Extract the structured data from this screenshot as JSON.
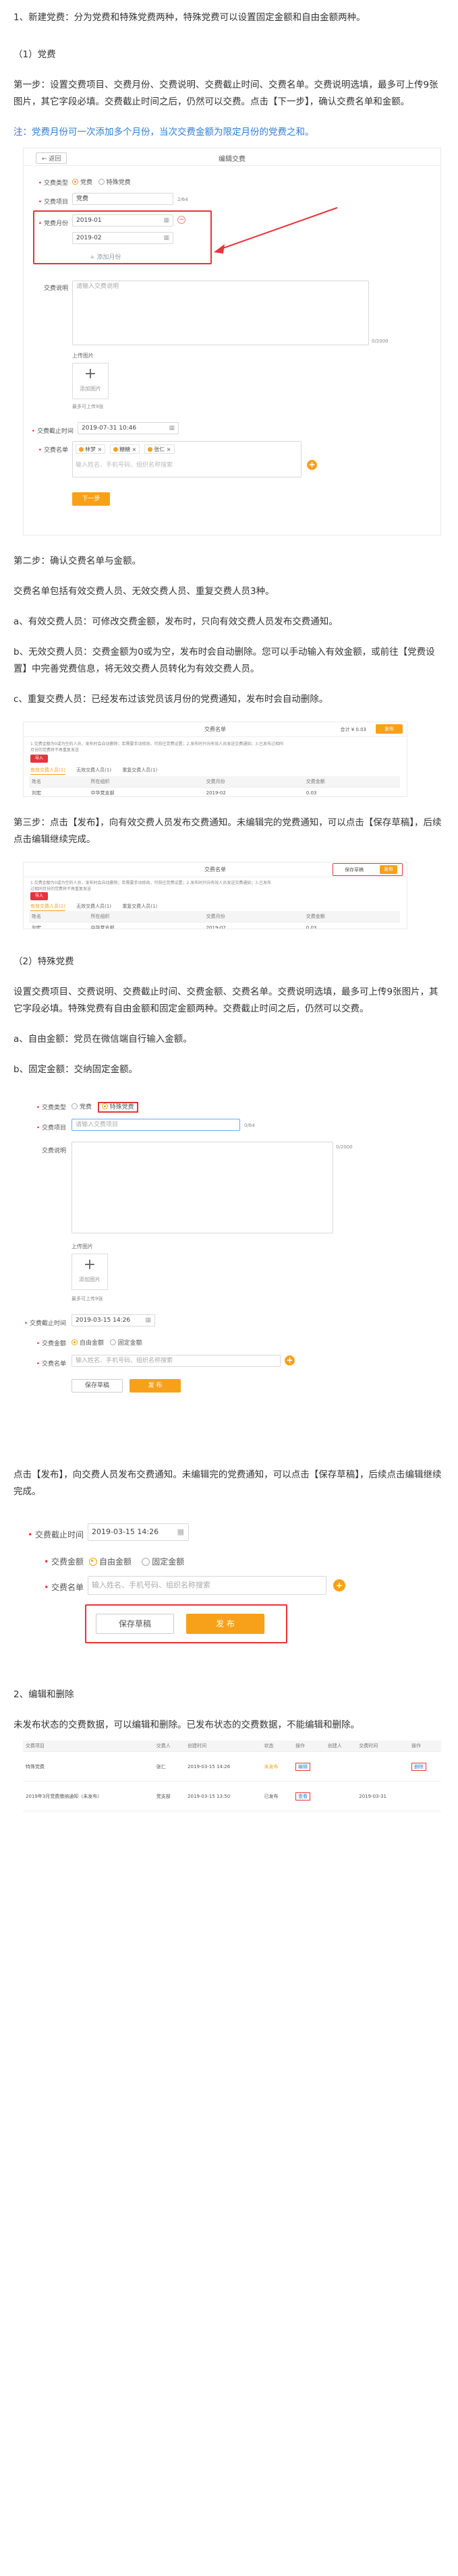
{
  "intro": "1、新建党费：分为党费和特殊党费两种，特殊党费可以设置固定金额和自由金额两种。",
  "section1": {
    "heading": "（1）党费",
    "step1": "第一步：设置交费项目、交费月份、交费说明、交费截止时间、交费名单。交费说明选填，最多可上传9张图片，其它字段必填。交费截止时间之后，仍然可以交费。点击【下一步】，确认交费名单和金额。",
    "note": "注：党费月份可一次添加多个月份，当次交费金额为限定月份的党费之和。",
    "form": {
      "back": "返回",
      "title": "编辑交费",
      "type_label": "交费类型",
      "type_options": [
        "党费",
        "特殊党费"
      ],
      "project_label": "交费项目",
      "project_value": "党费",
      "project_count": "2/64",
      "month_label": "党费月份",
      "months": [
        "2019-01",
        "2019-02"
      ],
      "add_month": "+ 添加月份",
      "desc_label": "交费说明",
      "desc_placeholder": "请输入交费说明",
      "desc_count": "0/2000",
      "upload_label": "上传图片",
      "upload_btn": "添加图片",
      "upload_tip": "最多可上传9张",
      "deadline_label": "交费截止时间",
      "deadline_value": "2019-07-31 10:46",
      "list_label": "交费名单",
      "list_tags": [
        "林梦",
        "糖糖",
        "张仁"
      ],
      "list_placeholder": "输入姓名、手机号码、组织名称搜索",
      "next_btn": "下一步"
    },
    "step2": "第二步：确认交费名单与金额。",
    "list_types": "交费名单包括有效交费人员、无效交费人员、重复交费人员3种。",
    "a": "a、有效交费人员：可修改交费金额，发布时，只向有效交费人员发布交费通知。",
    "b": "b、无效交费人员：交费金额为0或为空，发布时会自动删除。您可以手动输入有效金额，或前往【党费设置】中完善党费信息，将无效交费人员转化为有效交费人员。",
    "c": "c、重复交费人员：已经发布过该党员该月份的党费通知，发布时会自动删除。",
    "table1": {
      "title": "交费名单",
      "total_label": "合计 ¥ 0.03",
      "save_btn": "保存草稿",
      "publish_btn": "发布",
      "info": "1.交费金额为0或为空的人员，发布时会自动删除；若需要手动修改，可前往党费设置；2.发布时只向有效人员发送交费通知；3.已发布过相同月份的党费将不再重复发送",
      "import_btn": "导入",
      "tabs": [
        "有效交费人员(1)",
        "无效交费人员(1)",
        "重复交费人员(1)"
      ],
      "cols": [
        "姓名",
        "所在组织",
        "交费月份",
        "交费金额"
      ],
      "rows": [
        [
          "刘宏",
          "中华党支部",
          "2019-02",
          "0.03"
        ]
      ]
    },
    "step3": "第三步：点击【发布】，向有效交费人员发布交费通知。未编辑完的党费通知，可以点击【保存草稿】，后续点击编辑继续完成。"
  },
  "section2": {
    "heading": "（2）特殊党费",
    "desc": "设置交费项目、交费说明、交费截止时间、交费金额、交费名单。交费说明选填，最多可上传9张图片，其它字段必填。特殊党费有自由金额和固定金额两种。交费截止时间之后，仍然可以交费。",
    "a": "a、自由金额：党员在微信端自行输入金额。",
    "b": "b、固定金额：交纳固定金额。",
    "form": {
      "type_label": "交费类型",
      "type_options": [
        "党费",
        "特殊党费"
      ],
      "project_label": "交费项目",
      "project_placeholder": "请输入交费项目",
      "project_count": "0/64",
      "desc_label": "交费说明",
      "desc_count": "0/2000",
      "upload_label": "上传图片",
      "upload_btn": "添加图片",
      "upload_tip": "最多可上传9张",
      "deadline_label": "交费截止时间",
      "deadline_value": "2019-03-15 14:26",
      "amount_label": "交费金额",
      "amount_options": [
        "自由金额",
        "固定金额"
      ],
      "list_label": "交费名单",
      "list_placeholder": "输入姓名、手机号码、组织名称搜索",
      "save_btn": "保存草稿",
      "publish_btn": "发 布"
    },
    "publish_text": "点击【发布】，向交费人员发布交费通知。未编辑完的党费通知，可以点击【保存草稿】，后续点击编辑继续完成。",
    "zoom": {
      "deadline_label": "交费截止时间",
      "deadline_value": "2019-03-15 14:26",
      "amount_label": "交费金额",
      "amount_options": [
        "自由金额",
        "固定金额"
      ],
      "list_label": "交费名单",
      "list_placeholder": "输入姓名、手机号码、组织名称搜索",
      "save_btn": "保存草稿",
      "publish_btn": "发 布"
    }
  },
  "section3": {
    "heading": "2、编辑和删除",
    "desc": "未发布状态的交费数据，可以编辑和删除。已发布状态的交费数据，不能编辑和删除。",
    "table": {
      "cols": [
        "交费项目",
        "交费人",
        "创建时间",
        "交费截止",
        "状态",
        "操作",
        "创建人",
        "交费时间",
        "操作"
      ],
      "rows": [
        [
          "特殊党费",
          "张仁",
          "2019-03-15 14:26",
          "未发布",
          "编辑",
          "删除"
        ],
        [
          "2019年3月党费缴纳通知（未发布）",
          "党支部",
          "2019-03-15 13:50",
          "已发布",
          "查看",
          "2019-03-31"
        ]
      ]
    }
  },
  "colors": {
    "accent": "#f7a11b",
    "highlight": "#e8333a",
    "note": "#2f7fd6"
  }
}
